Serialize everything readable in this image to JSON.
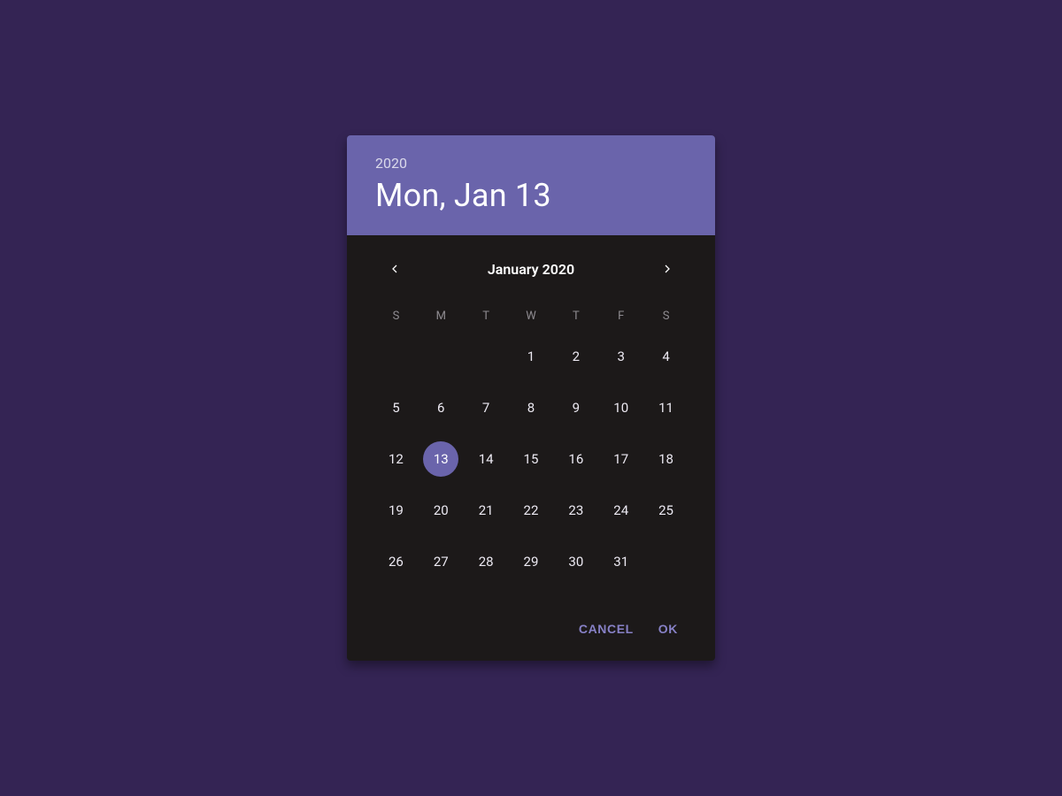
{
  "colors": {
    "background": "#342454",
    "accent": "#6a64ab",
    "panel": "#1c1919",
    "textLight": "#ece9f2",
    "actionText": "#8781c6"
  },
  "header": {
    "year": "2020",
    "date": "Mon, Jan 13"
  },
  "monthNav": {
    "title": "January 2020"
  },
  "weekdays": [
    "S",
    "M",
    "T",
    "W",
    "T",
    "F",
    "S"
  ],
  "days": [
    {
      "label": "",
      "selected": false
    },
    {
      "label": "",
      "selected": false
    },
    {
      "label": "",
      "selected": false
    },
    {
      "label": "1",
      "selected": false
    },
    {
      "label": "2",
      "selected": false
    },
    {
      "label": "3",
      "selected": false
    },
    {
      "label": "4",
      "selected": false
    },
    {
      "label": "5",
      "selected": false
    },
    {
      "label": "6",
      "selected": false
    },
    {
      "label": "7",
      "selected": false
    },
    {
      "label": "8",
      "selected": false
    },
    {
      "label": "9",
      "selected": false
    },
    {
      "label": "10",
      "selected": false
    },
    {
      "label": "11",
      "selected": false
    },
    {
      "label": "12",
      "selected": false
    },
    {
      "label": "13",
      "selected": true
    },
    {
      "label": "14",
      "selected": false
    },
    {
      "label": "15",
      "selected": false
    },
    {
      "label": "16",
      "selected": false
    },
    {
      "label": "17",
      "selected": false
    },
    {
      "label": "18",
      "selected": false
    },
    {
      "label": "19",
      "selected": false
    },
    {
      "label": "20",
      "selected": false
    },
    {
      "label": "21",
      "selected": false
    },
    {
      "label": "22",
      "selected": false
    },
    {
      "label": "23",
      "selected": false
    },
    {
      "label": "24",
      "selected": false
    },
    {
      "label": "25",
      "selected": false
    },
    {
      "label": "26",
      "selected": false
    },
    {
      "label": "27",
      "selected": false
    },
    {
      "label": "28",
      "selected": false
    },
    {
      "label": "29",
      "selected": false
    },
    {
      "label": "30",
      "selected": false
    },
    {
      "label": "31",
      "selected": false
    }
  ],
  "actions": {
    "cancel": "Cancel",
    "ok": "OK"
  }
}
